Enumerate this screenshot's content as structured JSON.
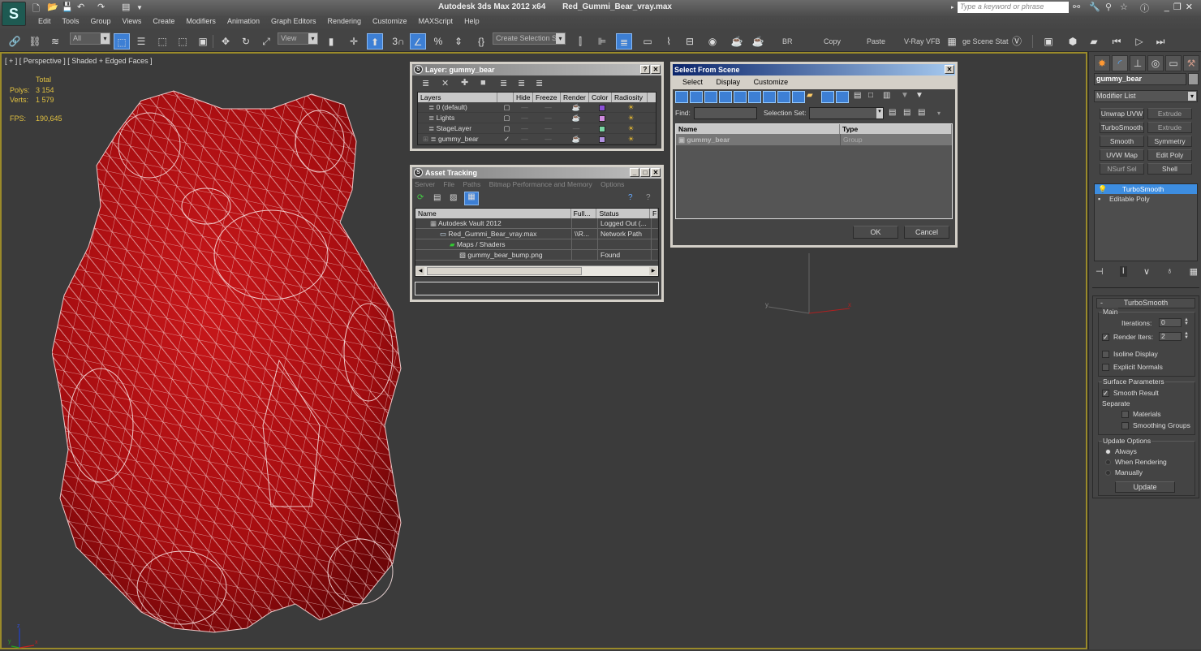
{
  "app": {
    "title": "Autodesk 3ds Max  2012 x64",
    "file": "Red_Gummi_Bear_vray.max",
    "logo_icon": "3dsmax-logo-icon",
    "search_placeholder": "Type a keyword or phrase"
  },
  "quick_access": [
    "new-file-icon",
    "open-file-icon",
    "save-icon",
    "undo-icon",
    "redo-icon",
    "project-folder-icon"
  ],
  "menu": [
    "Edit",
    "Tools",
    "Group",
    "Views",
    "Create",
    "Modifiers",
    "Animation",
    "Graph Editors",
    "Rendering",
    "Customize",
    "MAXScript",
    "Help"
  ],
  "toolbar": {
    "selection_filter": "All",
    "reference_coord": "View",
    "named_selection": "Create Selection Se",
    "snap_label": "3",
    "text_buttons": [
      "BR",
      "Copy",
      "Paste",
      "V-Ray VFB",
      "ge Scene Stat"
    ]
  },
  "viewport": {
    "label": "[ + ] [ Perspective ] [ Shaded + Edged Faces ]",
    "stats": {
      "header": "Total",
      "polys_label": "Polys:",
      "polys": "3 154",
      "verts_label": "Verts:",
      "verts": "1 579",
      "fps_label": "FPS:",
      "fps": "190,645"
    },
    "axis": {
      "x": "x",
      "y": "y",
      "z": "z"
    }
  },
  "layer_window": {
    "title": "Layer: gummy_bear",
    "columns": [
      "Layers",
      "",
      "Hide",
      "Freeze",
      "Render",
      "Color",
      "Radiosity"
    ],
    "rows": [
      {
        "name": "0 (default)",
        "current": false,
        "color": "#8a4fd6",
        "render": true
      },
      {
        "name": "Lights",
        "current": false,
        "color": "#d08adf",
        "render": true
      },
      {
        "name": "StageLayer",
        "current": false,
        "color": "#7ad6a4",
        "render": false
      },
      {
        "name": "gummy_bear",
        "current": true,
        "color": "#b090e0",
        "render": true
      }
    ]
  },
  "asset_tracking": {
    "title": "Asset Tracking",
    "menu": [
      "Server",
      "File",
      "Paths",
      "Bitmap Performance and Memory",
      "Options"
    ],
    "columns": [
      "Name",
      "Full...",
      "Status",
      "F"
    ],
    "rows": [
      {
        "name": "Autodesk Vault 2012",
        "full": "",
        "status": "Logged Out (...",
        "indent": 1
      },
      {
        "name": "Red_Gummi_Bear_vray.max",
        "full": "\\\\R...",
        "status": "Network Path",
        "indent": 2
      },
      {
        "name": "Maps / Shaders",
        "full": "",
        "status": "",
        "indent": 3
      },
      {
        "name": "gummy_bear_bump.png",
        "full": "",
        "status": "Found",
        "indent": 4
      }
    ]
  },
  "select_from_scene": {
    "title": "Select From Scene",
    "menu": [
      "Select",
      "Display",
      "Customize"
    ],
    "find_label": "Find:",
    "find_value": "",
    "selection_set_label": "Selection Set:",
    "columns": [
      "Name",
      "Type"
    ],
    "rows": [
      {
        "name": "gummy_bear",
        "type": "Group"
      }
    ],
    "ok": "OK",
    "cancel": "Cancel"
  },
  "command_panel": {
    "object_name": "gummy_bear",
    "modifier_list": "Modifier List",
    "modifier_buttons": [
      "Unwrap UVW",
      "Extrude",
      "TurboSmooth",
      "Extrude",
      "Smooth",
      "Symmetry",
      "UVW Map",
      "Edit Poly",
      "NSurf Sel",
      "Shell"
    ],
    "stack": [
      "TurboSmooth",
      "Editable Poly"
    ],
    "turbosmooth": {
      "title": "TurboSmooth",
      "main_label": "Main",
      "iterations_label": "Iterations:",
      "iterations": "0",
      "render_iters_label": "Render Iters:",
      "render_iters": "2",
      "render_iters_checked": true,
      "isoline_label": "Isoline Display",
      "isoline": false,
      "explicit_normals_label": "Explicit Normals",
      "explicit_normals": false,
      "surface_label": "Surface Parameters",
      "smooth_result_label": "Smooth Result",
      "smooth_result": true,
      "separate_label": "Separate",
      "materials_label": "Materials",
      "materials": false,
      "smoothing_groups_label": "Smoothing Groups",
      "smoothing_groups": false,
      "update_label": "Update Options",
      "update_options": [
        "Always",
        "When Rendering",
        "Manually"
      ],
      "update_selected": "Always",
      "update_button": "Update"
    }
  }
}
